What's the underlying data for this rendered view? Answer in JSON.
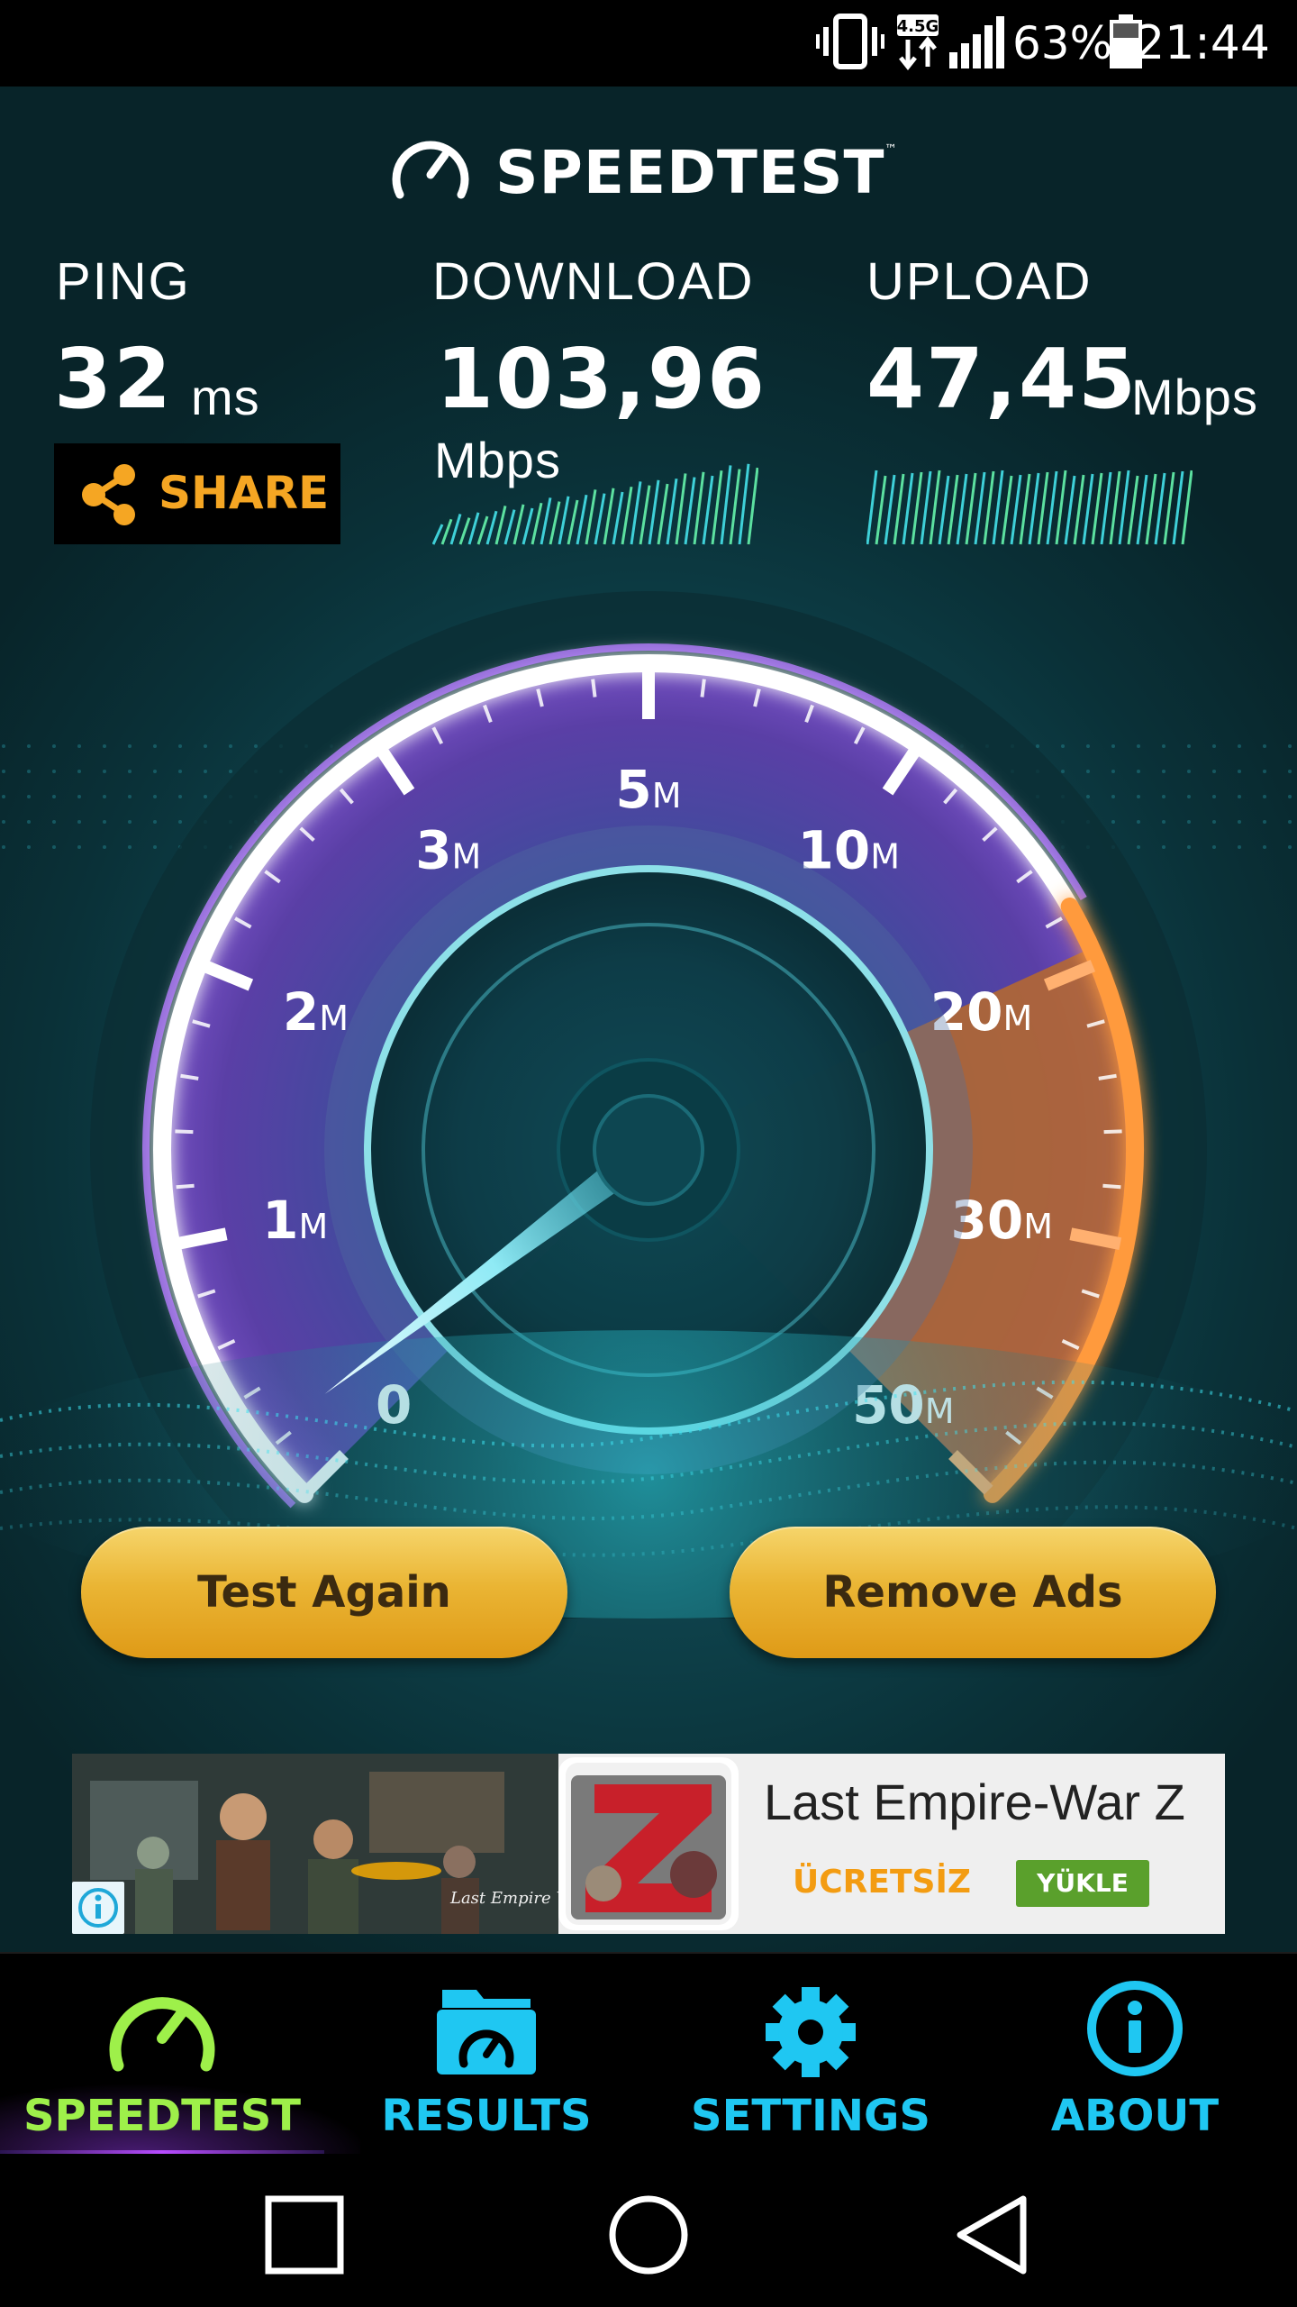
{
  "status_bar": {
    "network_type": "4.5G",
    "battery_percent": "63%",
    "time": "21:44",
    "icons": [
      "vibrate-icon",
      "data-transfer-icon",
      "signal-icon",
      "battery-icon"
    ]
  },
  "app": {
    "logo_text": "SPEEDTEST",
    "logo_tm": "™",
    "ping": {
      "label": "PING",
      "value": "32",
      "unit": "ms"
    },
    "download": {
      "label": "DOWNLOAD",
      "value": "103,96",
      "unit": "Mbps"
    },
    "upload": {
      "label": "UPLOAD",
      "value": "47,45",
      "unit": "Mbps"
    },
    "share_label": "SHARE",
    "gauge": {
      "ticks": [
        {
          "num": "0",
          "suffix": ""
        },
        {
          "num": "1",
          "suffix": "M"
        },
        {
          "num": "2",
          "suffix": "M"
        },
        {
          "num": "3",
          "suffix": "M"
        },
        {
          "num": "5",
          "suffix": "M"
        },
        {
          "num": "10",
          "suffix": "M"
        },
        {
          "num": "20",
          "suffix": "M"
        },
        {
          "num": "30",
          "suffix": "M"
        },
        {
          "num": "50",
          "suffix": "M"
        }
      ],
      "needle_level": 0
    },
    "buttons": {
      "test_again": "Test Again",
      "remove_ads": "Remove Ads"
    },
    "ad": {
      "title": "Last Empire-War Z",
      "price_label": "ÜCRETSİZ",
      "install_label": "YÜKLE",
      "art_caption": "Last Empire War"
    }
  },
  "bottom_nav": {
    "items": [
      {
        "label": "SPEEDTEST",
        "icon": "speedometer-icon",
        "active": true
      },
      {
        "label": "RESULTS",
        "icon": "folder-speedometer-icon",
        "active": false
      },
      {
        "label": "SETTINGS",
        "icon": "gear-icon",
        "active": false
      },
      {
        "label": "ABOUT",
        "icon": "info-icon",
        "active": false
      }
    ]
  },
  "system_nav": [
    "recents-button",
    "home-button",
    "back-button"
  ],
  "colors": {
    "accent_orange": "#f5a623",
    "accent_cyan": "#1fc7f2",
    "accent_green": "#9ef04a",
    "gauge_purple": "#6a4fb0",
    "button_yellow": "#eab534"
  }
}
